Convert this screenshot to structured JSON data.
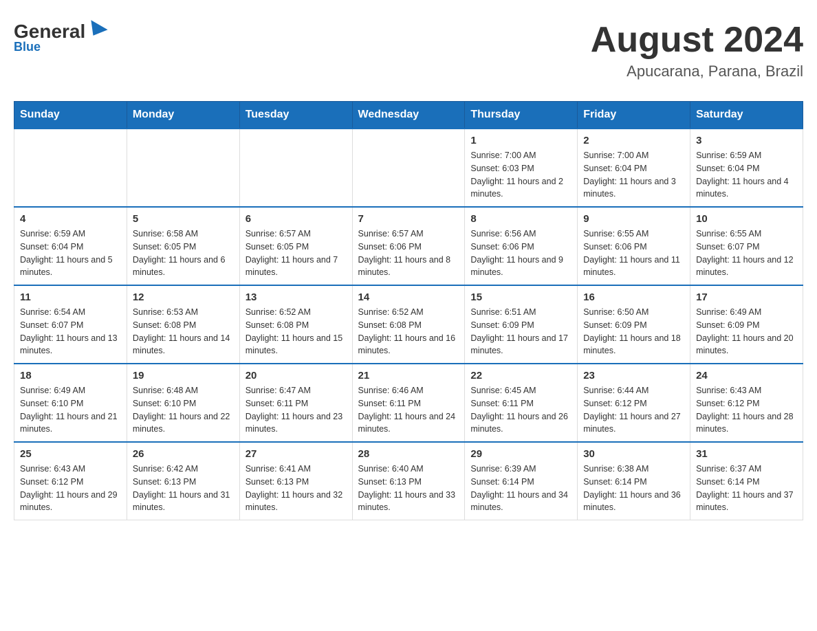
{
  "header": {
    "logo_general": "General",
    "logo_blue": "Blue",
    "main_title": "August 2024",
    "subtitle": "Apucarana, Parana, Brazil"
  },
  "days_of_week": [
    "Sunday",
    "Monday",
    "Tuesday",
    "Wednesday",
    "Thursday",
    "Friday",
    "Saturday"
  ],
  "weeks": [
    [
      {
        "day": "",
        "info": ""
      },
      {
        "day": "",
        "info": ""
      },
      {
        "day": "",
        "info": ""
      },
      {
        "day": "",
        "info": ""
      },
      {
        "day": "1",
        "info": "Sunrise: 7:00 AM\nSunset: 6:03 PM\nDaylight: 11 hours and 2 minutes."
      },
      {
        "day": "2",
        "info": "Sunrise: 7:00 AM\nSunset: 6:04 PM\nDaylight: 11 hours and 3 minutes."
      },
      {
        "day": "3",
        "info": "Sunrise: 6:59 AM\nSunset: 6:04 PM\nDaylight: 11 hours and 4 minutes."
      }
    ],
    [
      {
        "day": "4",
        "info": "Sunrise: 6:59 AM\nSunset: 6:04 PM\nDaylight: 11 hours and 5 minutes."
      },
      {
        "day": "5",
        "info": "Sunrise: 6:58 AM\nSunset: 6:05 PM\nDaylight: 11 hours and 6 minutes."
      },
      {
        "day": "6",
        "info": "Sunrise: 6:57 AM\nSunset: 6:05 PM\nDaylight: 11 hours and 7 minutes."
      },
      {
        "day": "7",
        "info": "Sunrise: 6:57 AM\nSunset: 6:06 PM\nDaylight: 11 hours and 8 minutes."
      },
      {
        "day": "8",
        "info": "Sunrise: 6:56 AM\nSunset: 6:06 PM\nDaylight: 11 hours and 9 minutes."
      },
      {
        "day": "9",
        "info": "Sunrise: 6:55 AM\nSunset: 6:06 PM\nDaylight: 11 hours and 11 minutes."
      },
      {
        "day": "10",
        "info": "Sunrise: 6:55 AM\nSunset: 6:07 PM\nDaylight: 11 hours and 12 minutes."
      }
    ],
    [
      {
        "day": "11",
        "info": "Sunrise: 6:54 AM\nSunset: 6:07 PM\nDaylight: 11 hours and 13 minutes."
      },
      {
        "day": "12",
        "info": "Sunrise: 6:53 AM\nSunset: 6:08 PM\nDaylight: 11 hours and 14 minutes."
      },
      {
        "day": "13",
        "info": "Sunrise: 6:52 AM\nSunset: 6:08 PM\nDaylight: 11 hours and 15 minutes."
      },
      {
        "day": "14",
        "info": "Sunrise: 6:52 AM\nSunset: 6:08 PM\nDaylight: 11 hours and 16 minutes."
      },
      {
        "day": "15",
        "info": "Sunrise: 6:51 AM\nSunset: 6:09 PM\nDaylight: 11 hours and 17 minutes."
      },
      {
        "day": "16",
        "info": "Sunrise: 6:50 AM\nSunset: 6:09 PM\nDaylight: 11 hours and 18 minutes."
      },
      {
        "day": "17",
        "info": "Sunrise: 6:49 AM\nSunset: 6:09 PM\nDaylight: 11 hours and 20 minutes."
      }
    ],
    [
      {
        "day": "18",
        "info": "Sunrise: 6:49 AM\nSunset: 6:10 PM\nDaylight: 11 hours and 21 minutes."
      },
      {
        "day": "19",
        "info": "Sunrise: 6:48 AM\nSunset: 6:10 PM\nDaylight: 11 hours and 22 minutes."
      },
      {
        "day": "20",
        "info": "Sunrise: 6:47 AM\nSunset: 6:11 PM\nDaylight: 11 hours and 23 minutes."
      },
      {
        "day": "21",
        "info": "Sunrise: 6:46 AM\nSunset: 6:11 PM\nDaylight: 11 hours and 24 minutes."
      },
      {
        "day": "22",
        "info": "Sunrise: 6:45 AM\nSunset: 6:11 PM\nDaylight: 11 hours and 26 minutes."
      },
      {
        "day": "23",
        "info": "Sunrise: 6:44 AM\nSunset: 6:12 PM\nDaylight: 11 hours and 27 minutes."
      },
      {
        "day": "24",
        "info": "Sunrise: 6:43 AM\nSunset: 6:12 PM\nDaylight: 11 hours and 28 minutes."
      }
    ],
    [
      {
        "day": "25",
        "info": "Sunrise: 6:43 AM\nSunset: 6:12 PM\nDaylight: 11 hours and 29 minutes."
      },
      {
        "day": "26",
        "info": "Sunrise: 6:42 AM\nSunset: 6:13 PM\nDaylight: 11 hours and 31 minutes."
      },
      {
        "day": "27",
        "info": "Sunrise: 6:41 AM\nSunset: 6:13 PM\nDaylight: 11 hours and 32 minutes."
      },
      {
        "day": "28",
        "info": "Sunrise: 6:40 AM\nSunset: 6:13 PM\nDaylight: 11 hours and 33 minutes."
      },
      {
        "day": "29",
        "info": "Sunrise: 6:39 AM\nSunset: 6:14 PM\nDaylight: 11 hours and 34 minutes."
      },
      {
        "day": "30",
        "info": "Sunrise: 6:38 AM\nSunset: 6:14 PM\nDaylight: 11 hours and 36 minutes."
      },
      {
        "day": "31",
        "info": "Sunrise: 6:37 AM\nSunset: 6:14 PM\nDaylight: 11 hours and 37 minutes."
      }
    ]
  ]
}
